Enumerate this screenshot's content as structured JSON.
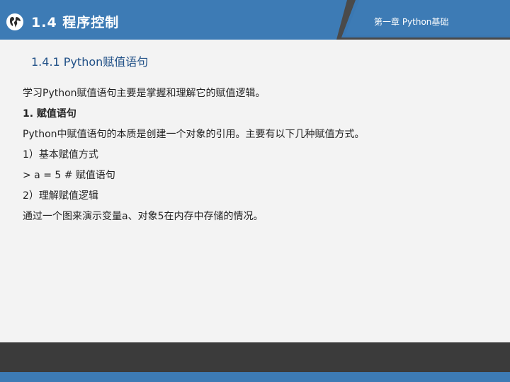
{
  "header": {
    "section_title": "1.4  程序控制",
    "chapter": "第一章 Python基础",
    "colors": {
      "band": "#3d7bb5",
      "panel": "#2f6aa3",
      "stripe": "#5f6f7e"
    }
  },
  "subtitle": "1.4.1  Python赋值语句",
  "content": {
    "lines": [
      {
        "text": "学习Python赋值语句主要是掌握和理解它的赋值逻辑。",
        "bold": false
      },
      {
        "text": "1. 赋值语句",
        "bold": true
      },
      {
        "text": "Python中赋值语句的本质是创建一个对象的引用。主要有以下几种赋值方式。",
        "bold": false
      },
      {
        "text": "1）基本赋值方式",
        "bold": false
      },
      {
        "text": "> a = 5  # 赋值语句",
        "bold": false
      },
      {
        "text": "2）理解赋值逻辑",
        "bold": false
      },
      {
        "text": "通过一个图来演示变量a、对象5在内存中存储的情况。",
        "bold": false
      }
    ]
  },
  "icons": {
    "header_logo": "globe-icon"
  }
}
